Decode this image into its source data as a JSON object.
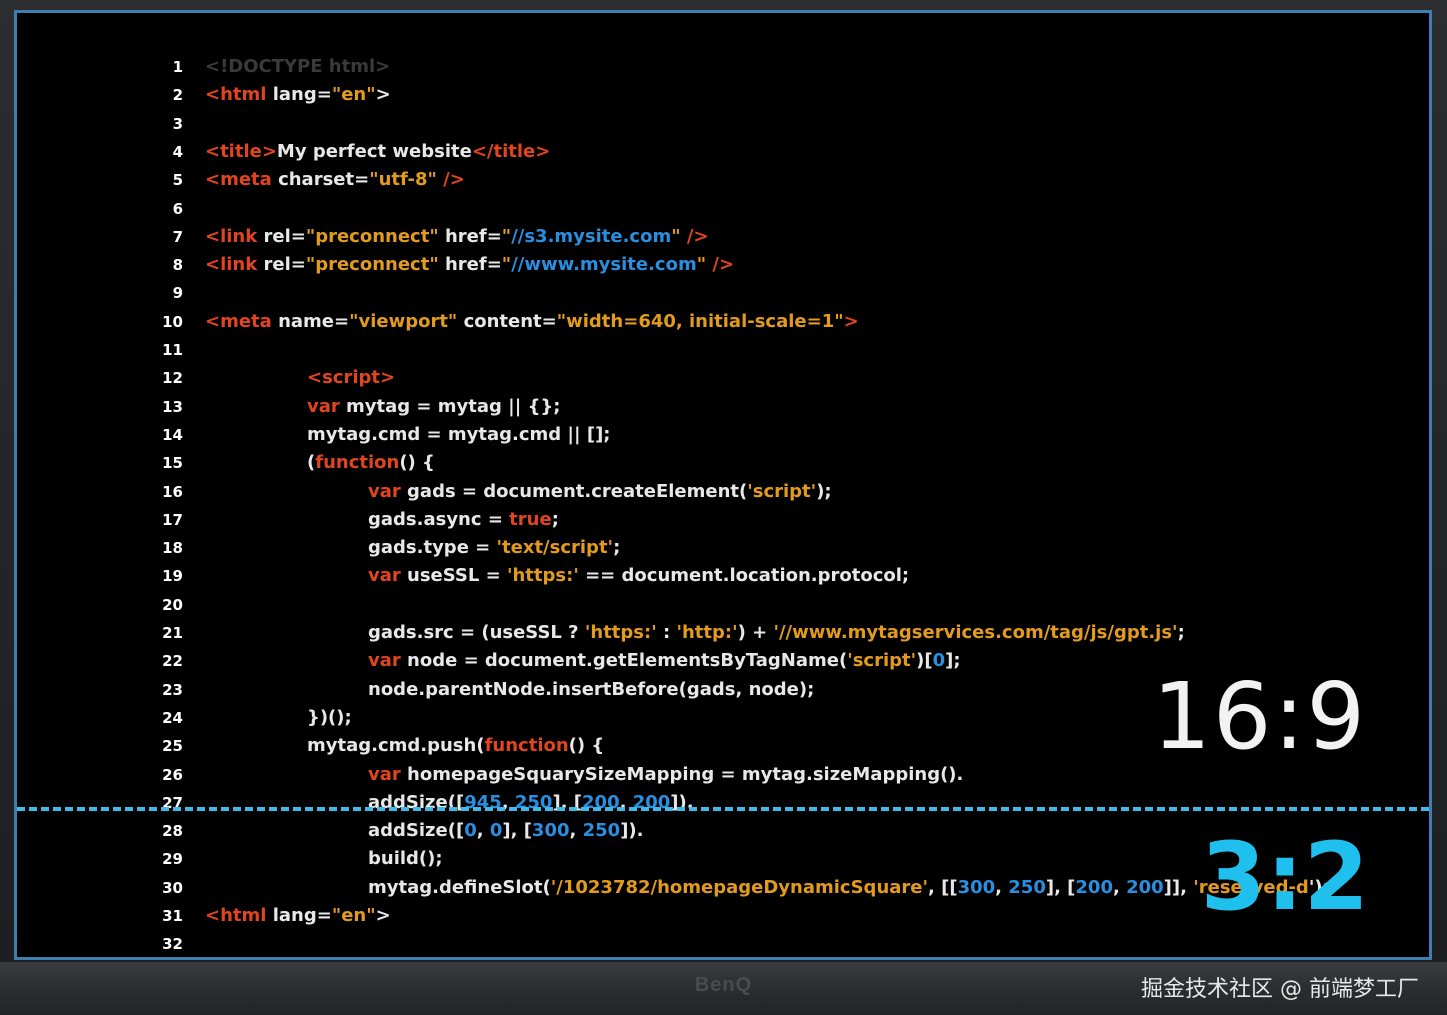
{
  "screen": {
    "code_lines": [
      {
        "n": "1",
        "segs": [
          {
            "t": "<!DOCTYPE html>",
            "c": "dim"
          }
        ]
      },
      {
        "n": "2",
        "segs": [
          {
            "t": "<html",
            "c": "tag"
          },
          {
            "t": " lang=",
            "c": "pl"
          },
          {
            "t": "\"en\"",
            "c": "str"
          },
          {
            "t": ">",
            "c": "pl"
          }
        ]
      },
      {
        "n": "3",
        "segs": []
      },
      {
        "n": "4",
        "segs": [
          {
            "t": "<title>",
            "c": "tag"
          },
          {
            "t": "My perfect website",
            "c": "pl"
          },
          {
            "t": "</title>",
            "c": "tag"
          }
        ]
      },
      {
        "n": "5",
        "segs": [
          {
            "t": "<meta",
            "c": "tag"
          },
          {
            "t": " charset=",
            "c": "pl"
          },
          {
            "t": "\"utf-8\"",
            "c": "str"
          },
          {
            "t": " />",
            "c": "tag"
          }
        ]
      },
      {
        "n": "6",
        "segs": []
      },
      {
        "n": "7",
        "segs": [
          {
            "t": "<link",
            "c": "tag"
          },
          {
            "t": " rel=",
            "c": "pl"
          },
          {
            "t": "\"preconnect\"",
            "c": "str"
          },
          {
            "t": " href=",
            "c": "pl"
          },
          {
            "t": "\"",
            "c": "str"
          },
          {
            "t": "//s3.mysite.com",
            "c": "url"
          },
          {
            "t": "\"",
            "c": "str"
          },
          {
            "t": " />",
            "c": "tag"
          }
        ]
      },
      {
        "n": "8",
        "segs": [
          {
            "t": "<link",
            "c": "tag"
          },
          {
            "t": " rel=",
            "c": "pl"
          },
          {
            "t": "\"preconnect\"",
            "c": "str"
          },
          {
            "t": " href=",
            "c": "pl"
          },
          {
            "t": "\"",
            "c": "str"
          },
          {
            "t": "//www.mysite.com",
            "c": "url"
          },
          {
            "t": "\"",
            "c": "str"
          },
          {
            "t": " />",
            "c": "tag"
          }
        ]
      },
      {
        "n": "9",
        "segs": []
      },
      {
        "n": "10",
        "segs": [
          {
            "t": "<meta",
            "c": "tag"
          },
          {
            "t": " name=",
            "c": "pl"
          },
          {
            "t": "\"viewport\"",
            "c": "str"
          },
          {
            "t": " content=",
            "c": "pl"
          },
          {
            "t": "\"width=640, initial-scale=1\"",
            "c": "str"
          },
          {
            "t": ">",
            "c": "tag"
          }
        ]
      },
      {
        "n": "11",
        "segs": []
      },
      {
        "n": "12",
        "indent": 1,
        "segs": [
          {
            "t": "<script>",
            "c": "tag"
          }
        ]
      },
      {
        "n": "13",
        "indent": 1,
        "segs": [
          {
            "t": "var",
            "c": "kw"
          },
          {
            "t": " mytag = mytag || {};",
            "c": "pl"
          }
        ]
      },
      {
        "n": "14",
        "indent": 1,
        "segs": [
          {
            "t": "mytag.cmd = mytag.cmd || [];",
            "c": "pl"
          }
        ]
      },
      {
        "n": "15",
        "indent": 1,
        "segs": [
          {
            "t": "(",
            "c": "pl"
          },
          {
            "t": "function",
            "c": "kw"
          },
          {
            "t": "() {",
            "c": "pl"
          }
        ]
      },
      {
        "n": "16",
        "indent": 2,
        "segs": [
          {
            "t": "var",
            "c": "kw"
          },
          {
            "t": " gads = document.createElement(",
            "c": "pl"
          },
          {
            "t": "'script'",
            "c": "str"
          },
          {
            "t": ");",
            "c": "pl"
          }
        ]
      },
      {
        "n": "17",
        "indent": 2,
        "segs": [
          {
            "t": "gads.async = ",
            "c": "pl"
          },
          {
            "t": "true",
            "c": "kw"
          },
          {
            "t": ";",
            "c": "pl"
          }
        ]
      },
      {
        "n": "18",
        "indent": 2,
        "segs": [
          {
            "t": "gads.type = ",
            "c": "pl"
          },
          {
            "t": "'text/script'",
            "c": "str"
          },
          {
            "t": ";",
            "c": "pl"
          }
        ]
      },
      {
        "n": "19",
        "indent": 2,
        "segs": [
          {
            "t": "var",
            "c": "kw"
          },
          {
            "t": " useSSL = ",
            "c": "pl"
          },
          {
            "t": "'https:'",
            "c": "str"
          },
          {
            "t": " == document.location.protocol;",
            "c": "pl"
          }
        ]
      },
      {
        "n": "20",
        "segs": []
      },
      {
        "n": "21",
        "indent": 2,
        "segs": [
          {
            "t": "gads.src = (useSSL ? ",
            "c": "pl"
          },
          {
            "t": "'https:'",
            "c": "str"
          },
          {
            "t": " : ",
            "c": "pl"
          },
          {
            "t": "'http:'",
            "c": "str"
          },
          {
            "t": ") + ",
            "c": "pl"
          },
          {
            "t": "'//www.mytagservices.com/tag/js/gpt.js'",
            "c": "str"
          },
          {
            "t": ";",
            "c": "pl"
          }
        ]
      },
      {
        "n": "22",
        "indent": 2,
        "segs": [
          {
            "t": "var",
            "c": "kw"
          },
          {
            "t": " node = document.getElementsByTagName(",
            "c": "pl"
          },
          {
            "t": "'script'",
            "c": "str"
          },
          {
            "t": ")[",
            "c": "pl"
          },
          {
            "t": "0",
            "c": "num"
          },
          {
            "t": "];",
            "c": "pl"
          }
        ]
      },
      {
        "n": "23",
        "indent": 2,
        "segs": [
          {
            "t": "node.parentNode.insertBefore(gads, node);",
            "c": "pl"
          }
        ]
      },
      {
        "n": "24",
        "indent": 1,
        "segs": [
          {
            "t": "})();",
            "c": "pl"
          }
        ]
      },
      {
        "n": "25",
        "indent": 1,
        "segs": [
          {
            "t": "mytag.cmd.push(",
            "c": "pl"
          },
          {
            "t": "function",
            "c": "kw"
          },
          {
            "t": "() {",
            "c": "pl"
          }
        ]
      },
      {
        "n": "26",
        "indent": 2,
        "segs": [
          {
            "t": "var",
            "c": "kw"
          },
          {
            "t": " homepageSquarySizeMapping = mytag.sizeMapping().",
            "c": "pl"
          }
        ]
      },
      {
        "n": "27",
        "indent": 2,
        "segs": [
          {
            "t": "addSize([",
            "c": "pl"
          },
          {
            "t": "945",
            "c": "num"
          },
          {
            "t": ", ",
            "c": "pl"
          },
          {
            "t": "250",
            "c": "num"
          },
          {
            "t": "], [",
            "c": "pl"
          },
          {
            "t": "200",
            "c": "num"
          },
          {
            "t": ", ",
            "c": "pl"
          },
          {
            "t": "200",
            "c": "num"
          },
          {
            "t": "]).",
            "c": "pl"
          }
        ]
      },
      {
        "n": "28",
        "indent": 2,
        "segs": [
          {
            "t": "addSize([",
            "c": "pl"
          },
          {
            "t": "0",
            "c": "num"
          },
          {
            "t": ", ",
            "c": "pl"
          },
          {
            "t": "0",
            "c": "num"
          },
          {
            "t": "], [",
            "c": "pl"
          },
          {
            "t": "300",
            "c": "num"
          },
          {
            "t": ", ",
            "c": "pl"
          },
          {
            "t": "250",
            "c": "num"
          },
          {
            "t": "]).",
            "c": "pl"
          }
        ]
      },
      {
        "n": "29",
        "indent": 2,
        "segs": [
          {
            "t": "build();",
            "c": "pl"
          }
        ]
      },
      {
        "n": "30",
        "indent": 2,
        "segs": [
          {
            "t": "mytag.defineSlot(",
            "c": "pl"
          },
          {
            "t": "'/1023782/homepageDynamicSquare'",
            "c": "str"
          },
          {
            "t": ", [[",
            "c": "pl"
          },
          {
            "t": "300",
            "c": "num"
          },
          {
            "t": ", ",
            "c": "pl"
          },
          {
            "t": "250",
            "c": "num"
          },
          {
            "t": "], [",
            "c": "pl"
          },
          {
            "t": "200",
            "c": "num"
          },
          {
            "t": ", ",
            "c": "pl"
          },
          {
            "t": "200",
            "c": "num"
          },
          {
            "t": "]], ",
            "c": "pl"
          },
          {
            "t": "'reserved-d",
            "c": "str"
          },
          {
            "t": "');",
            "c": "pl"
          }
        ]
      },
      {
        "n": "31",
        "segs": [
          {
            "t": "<html",
            "c": "tag"
          },
          {
            "t": " lang=",
            "c": "pl"
          },
          {
            "t": "\"en\"",
            "c": "str"
          },
          {
            "t": ">",
            "c": "pl"
          }
        ]
      },
      {
        "n": "32",
        "segs": []
      }
    ],
    "ratio_top": "16:9",
    "ratio_bottom": "3:2",
    "colors": {
      "tag": "#e0451f",
      "string": "#e39b1e",
      "number": "#2a8fe0",
      "dashed_line": "#3fb9e8",
      "ratio_bottom": "#1fc0ee"
    }
  },
  "bezel": {
    "brand": "BenQ",
    "watermark": "掘金技术社区 @ 前端梦工厂"
  }
}
